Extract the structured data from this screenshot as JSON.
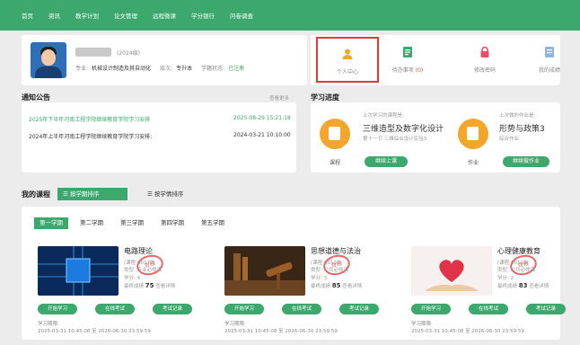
{
  "nav": {
    "items": [
      "首页",
      "资讯",
      "教学计划",
      "论文管理",
      "远程微课",
      "学分银行",
      "问卷调查"
    ]
  },
  "profile": {
    "grade": "(2024级)",
    "major_label": "专业:",
    "major": "机械设计制造及其自动化",
    "level_label": "层次:",
    "level": "专升本",
    "status_label": "学籍状态:",
    "status": "已注册"
  },
  "quick": {
    "personal_center": "个人中心",
    "todo": "待办事项",
    "todo_count": "(0)",
    "change_password": "修改密码",
    "my_scores": "我的成绩"
  },
  "notice": {
    "title": "通知公告",
    "more": "查看更多",
    "items": [
      {
        "text": "2025年下半年河南工程学院继续教育学院学习安排",
        "date": "2025-08-29 15:21:18"
      },
      {
        "text": "2024年上半年河南工程学院继续教育学院学习安排:",
        "date": "2024-03-21 10:10:00"
      }
    ]
  },
  "progress": {
    "title": "学习进度",
    "course_label": "课程",
    "course_last": "上次学习的课程是:",
    "course_name": "三维造型及数字化设计",
    "course_section": "第十一节 三维综合设计实验3",
    "course_button": "继续上课",
    "homework_label": "作业",
    "homework_last": "上次做的作业是:",
    "homework_name": "形势与政策3",
    "homework_section": "综合作业",
    "homework_button": "继续做作业"
  },
  "courses": {
    "title": "我的课程",
    "sort_term": "按学期排序",
    "sort_status": "按学情排序",
    "tabs": [
      "第一学期",
      "第二学期",
      "第三学期",
      "第四学期",
      "第五学期"
    ],
    "stamp": "合格",
    "score_suffix": "查看详情",
    "items": [
      {
        "name": "电路理论",
        "code": "(课程:00177)",
        "type": "类型: 专业必修课",
        "credit": "学分: 4",
        "score_label": "最终成绩",
        "score": "75",
        "btn1": "开始学习",
        "btn2": "在线考试",
        "btn3": "考试记录",
        "date_label": "学习期限:",
        "date_range": "2025-03-31 10:45:08 至 2026-06-30 23:59:59"
      },
      {
        "name": "思想道德与法治",
        "code": "(课程:00127)",
        "type": "类型: 公共必修课",
        "credit": "学分: 3",
        "score_label": "最终成绩",
        "score": "85",
        "btn1": "开始学习",
        "btn2": "在线考试",
        "btn3": "考试记录",
        "date_label": "学习期限:",
        "date_range": "2025-03-31 10:45:08 至 2026-06-30 23:59:59"
      },
      {
        "name": "心理健康教育",
        "code": "(课程:00128)",
        "type": "类型: 公共必修课",
        "credit": "学分: 2",
        "score_label": "最终成绩",
        "score": "83",
        "btn1": "开始学习",
        "btn2": "在线考试",
        "btn3": "考试记录",
        "date_label": "学习期限:",
        "date_range": "2025-03-31 10:45:08 至 2026-06-30 23:59:59"
      }
    ]
  }
}
